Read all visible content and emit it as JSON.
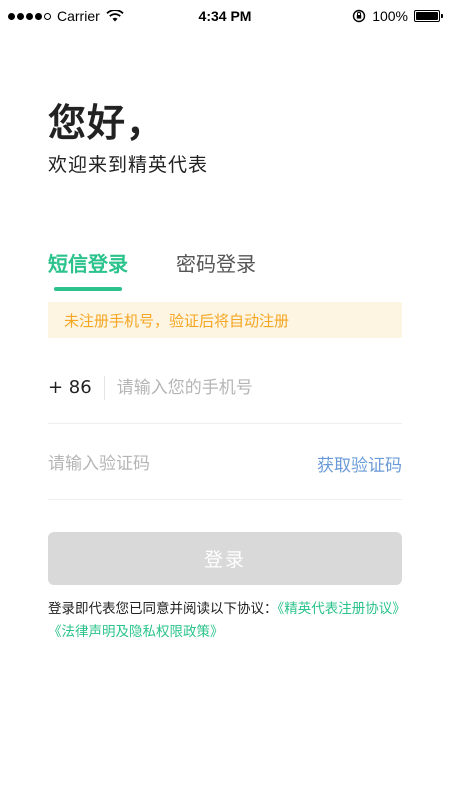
{
  "status_bar": {
    "carrier": "Carrier",
    "time": "4:34 PM",
    "battery": "100%"
  },
  "header": {
    "greeting": "您好，",
    "welcome": "欢迎来到精英代表"
  },
  "tabs": [
    {
      "label": "短信登录",
      "active": true
    },
    {
      "label": "密码登录",
      "active": false
    }
  ],
  "notice": "未注册手机号，验证后将自动注册",
  "phone_field": {
    "prefix": "+ 86",
    "placeholder": "请输入您的手机号"
  },
  "code_field": {
    "placeholder": "请输入验证码",
    "get_code_label": "获取验证码"
  },
  "login_button": "登录",
  "agreement": {
    "text": "登录即代表您已同意并阅读以下协议：",
    "link1": "《精英代表注册协议》",
    "link2": "《法律声明及隐私权限政策》"
  },
  "colors": {
    "accent": "#2bc38b",
    "notice_bg": "#fdf4e1",
    "notice_text": "#f5a623",
    "link_blue": "#6a9bd8",
    "button_disabled": "#d9d9d9"
  }
}
